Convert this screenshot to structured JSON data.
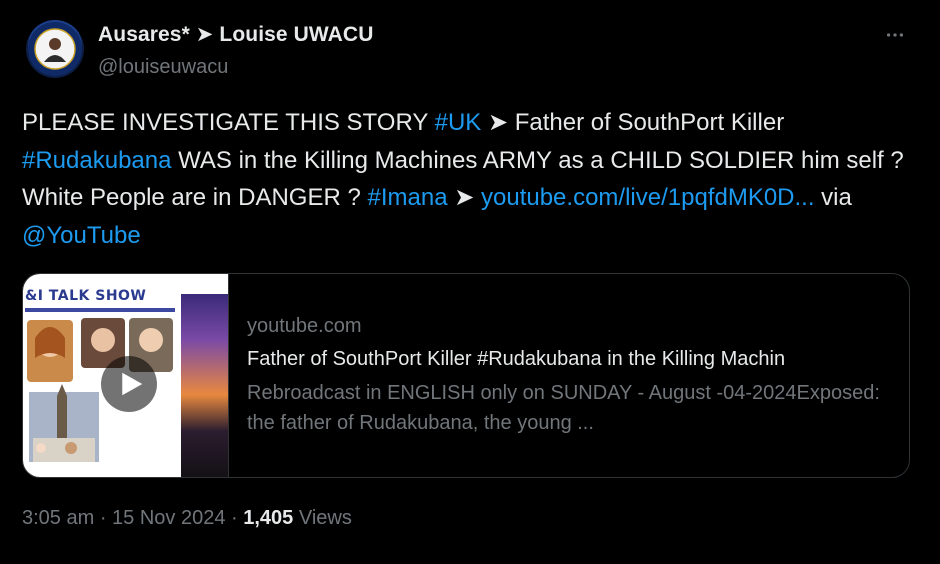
{
  "author": {
    "display_name": "Ausares* ➤ Louise UWACU",
    "handle": "@louiseuwacu"
  },
  "tweet": {
    "segments": [
      {
        "text": "PLEASE INVESTIGATE THIS STORY ",
        "kind": "text"
      },
      {
        "text": "#UK",
        "kind": "hashtag"
      },
      {
        "text": " ➤ Father of SouthPort Killer ",
        "kind": "text"
      },
      {
        "text": "#Rudakubana",
        "kind": "hashtag"
      },
      {
        "text": " WAS in the Killing Machines ARMY as a CHILD SOLDIER him self ? White People are in DANGER ? ",
        "kind": "text"
      },
      {
        "text": "#Imana",
        "kind": "hashtag"
      },
      {
        "text": " ➤ ",
        "kind": "text"
      },
      {
        "text": "youtube.com/live/1pqfdMK0D...",
        "kind": "url"
      },
      {
        "text": " via ",
        "kind": "text"
      },
      {
        "text": "@YouTube",
        "kind": "mention"
      }
    ]
  },
  "card": {
    "domain": "youtube.com",
    "title": "Father of SouthPort Killer #Rudakubana in the Killing Machin",
    "description": "Rebroadcast in ENGLISH only on SUNDAY - August -04-2024Exposed: the father of Rudakubana, the young ...",
    "thumbnail_title": "&I TALK SHOW"
  },
  "meta": {
    "time": "3:05 am",
    "separator": " · ",
    "date": "15 Nov 2024",
    "views_count": "1,405",
    "views_label": "Views"
  },
  "colors": {
    "background": "#000000",
    "text": "#e7e9ea",
    "muted": "#71767b",
    "link": "#1d9bf0",
    "border": "#2f3336"
  },
  "icons": {
    "more": "more-dots-icon",
    "play": "play-icon"
  }
}
